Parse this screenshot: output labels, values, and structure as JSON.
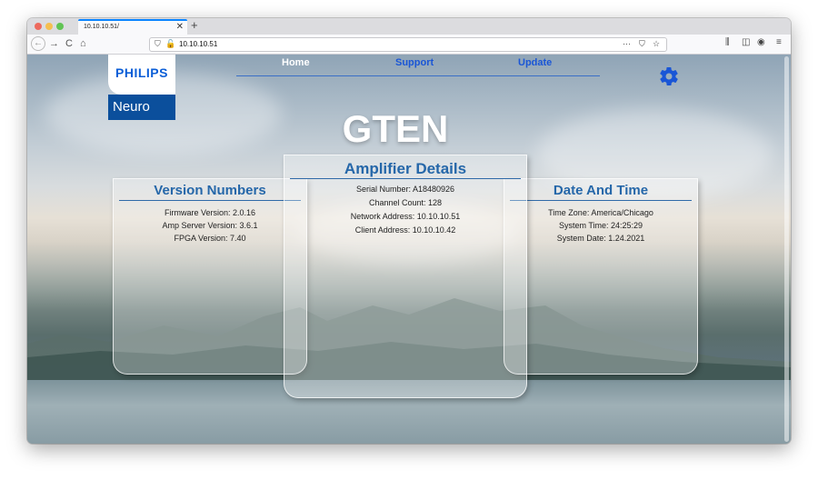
{
  "browser": {
    "tab_title": "10.10.10.51/",
    "tab_close": "✕",
    "new_tab": "+",
    "url": "10.10.10.51",
    "url_more": "···",
    "nav_back": "←",
    "nav_forward": "→",
    "nav_reload": "C",
    "nav_home": "⌂"
  },
  "logo": {
    "brand": "PHILIPS",
    "sub": "Neuro"
  },
  "nav": {
    "home": "Home",
    "support": "Support",
    "update": "Update"
  },
  "device_name": "GTEN",
  "version_numbers": {
    "title": "Version Numbers",
    "firmware": "Firmware Version: 2.0.16",
    "amp_server": "Amp Server Version: 3.6.1",
    "fpga": "FPGA Version: 7.40"
  },
  "amplifier_details": {
    "title": "Amplifier Details",
    "serial": "Serial Number: A18480926",
    "channels": "Channel Count: 128",
    "network": "Network Address: 10.10.10.51",
    "client": "Client Address: 10.10.10.42"
  },
  "date_time": {
    "title": "Date And Time",
    "timezone": "Time Zone: America/Chicago",
    "system_time": "System Time: 24:25:29",
    "system_date": "System Date: 1.24.2021"
  },
  "colors": {
    "brand_blue": "#0b4f9c",
    "link_blue": "#1a56d6",
    "panel_title_blue": "#2567a9"
  }
}
